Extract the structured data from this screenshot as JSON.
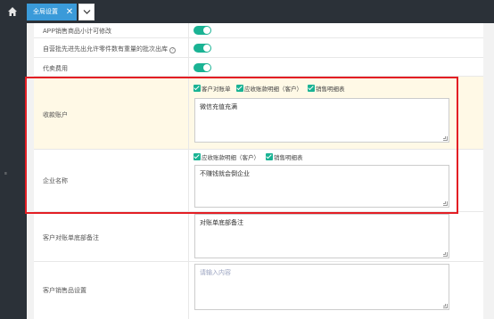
{
  "tabs": {
    "home_icon": "home-icon",
    "active_tab": "全局设置",
    "close_glyph": "✕",
    "more_icon": "chevron-down-icon"
  },
  "settings": {
    "app_subtotal_label": "APP销售商品小计可修改",
    "fifo_batch_label": "自营批先进先出允许零件数有重量的批次出库",
    "agent_fee_label": "代卖费用",
    "toggles": {
      "app_subtotal": true,
      "fifo_batch": true,
      "agent_fee": true
    }
  },
  "collection_account": {
    "label": "收款账户",
    "checkboxes": [
      "客户对账单",
      "应收账款明细（客户）",
      "销售明细表"
    ],
    "value": "微信充值充满"
  },
  "company_name": {
    "label": "企业名称",
    "checkboxes": [
      "应收账款明细（客户）",
      "销售明细表"
    ],
    "value": "不赚钱就会倒企业"
  },
  "statement_note": {
    "label": "客户对账单底部备注",
    "value": "对账单底部备注"
  },
  "sales_goods": {
    "label": "客户销售品设置",
    "placeholder": "请输入内容"
  },
  "colors": {
    "accent": "#1ab394",
    "tab": "#3a9ad9",
    "highlight": "#e31e24"
  }
}
